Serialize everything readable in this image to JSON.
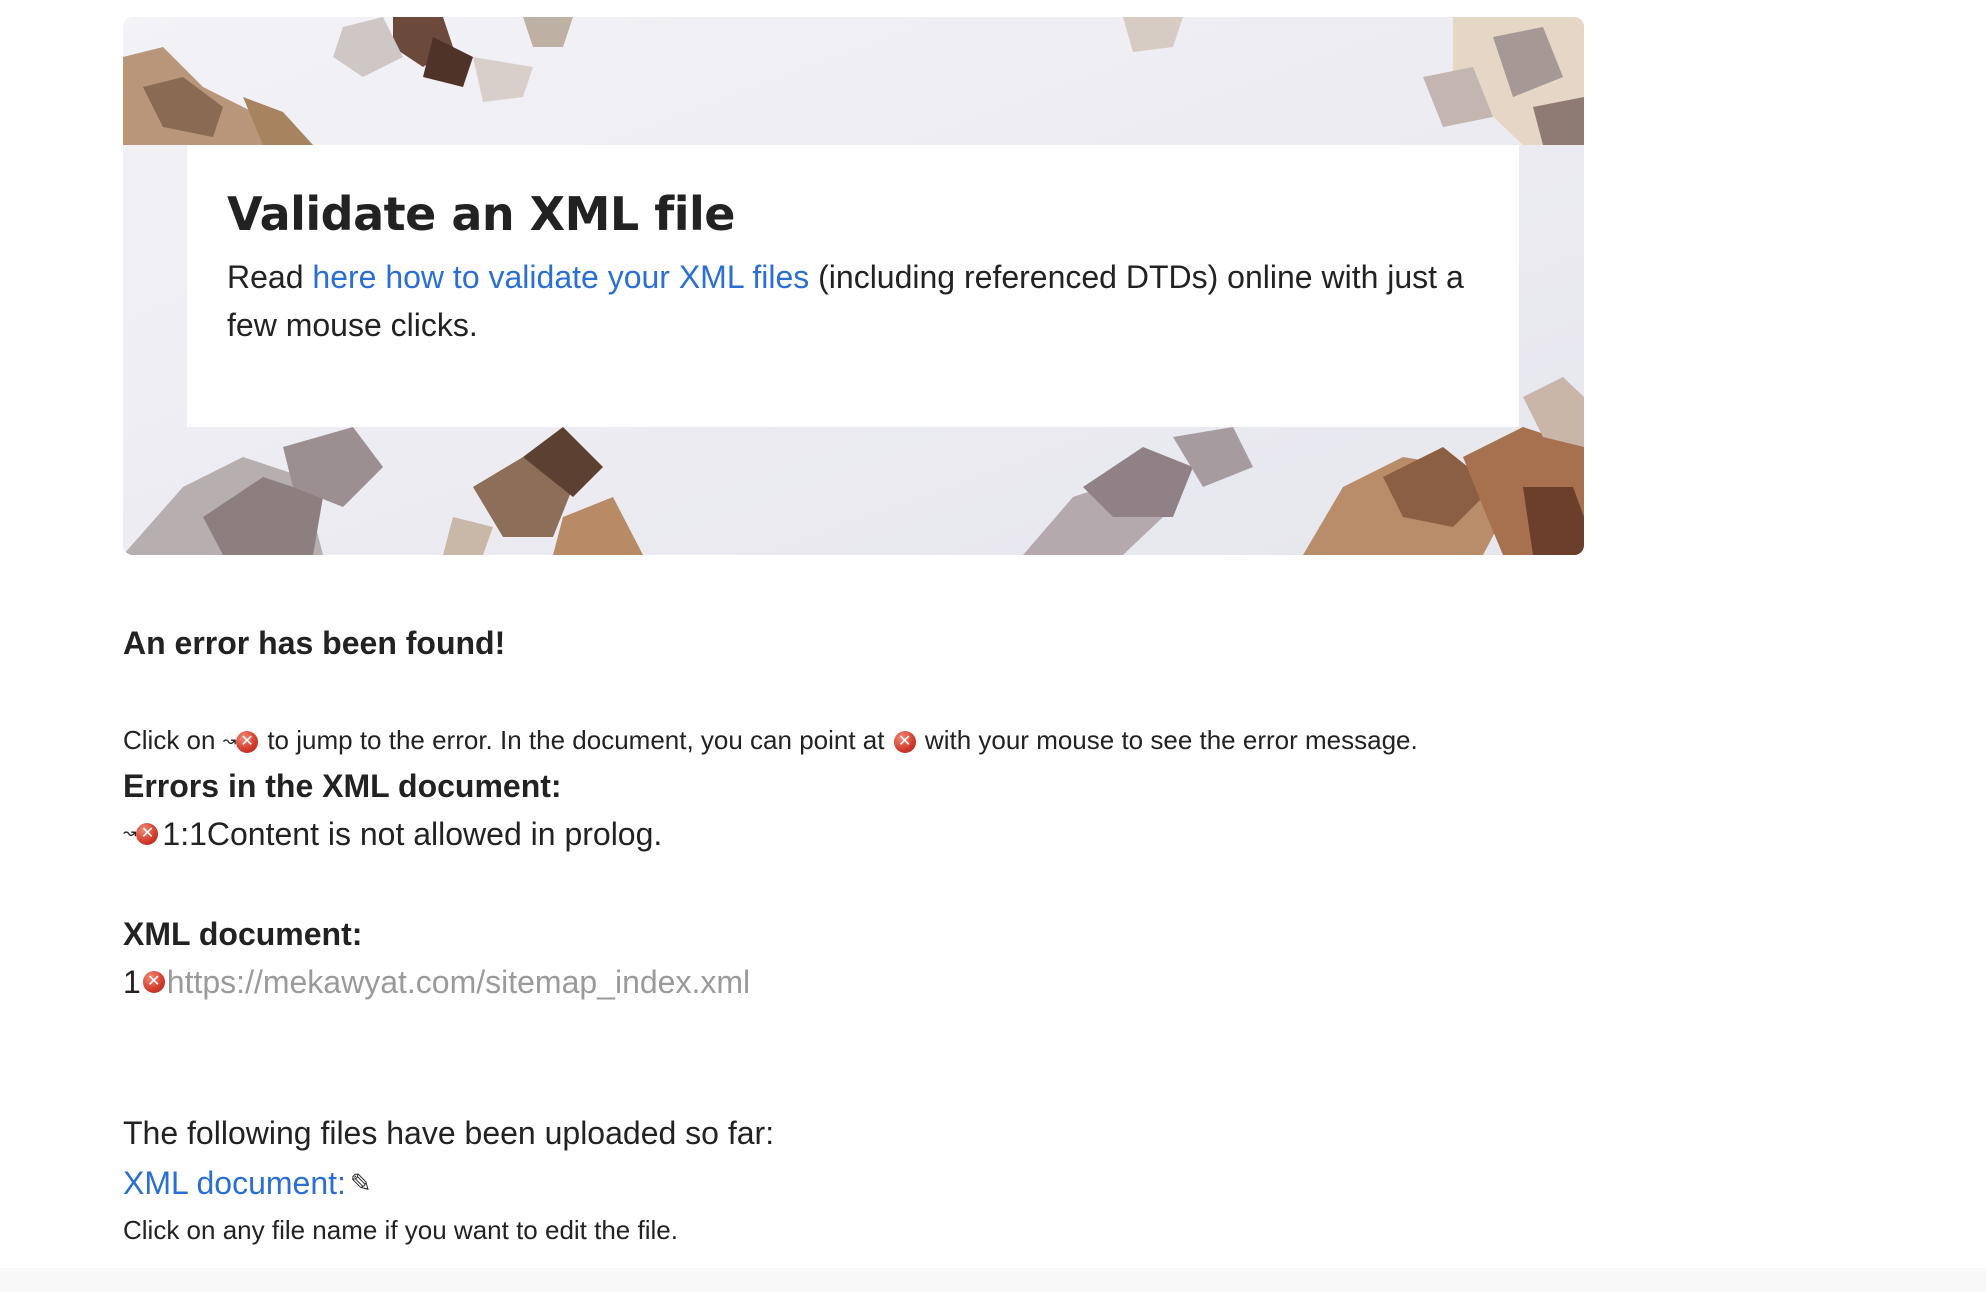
{
  "hero": {
    "title": "Validate an XML file",
    "lead_prefix": "Read ",
    "lead_link": "here how to validate your XML files",
    "lead_suffix": " (including referenced DTDs) online with just a few mouse clicks."
  },
  "result": {
    "heading": "An error has been found!",
    "hint_part1": "Click on ",
    "hint_part2": " to jump to the error. In the document, you can point at ",
    "hint_part3": " with your mouse to see the error message."
  },
  "errors": {
    "heading": "Errors in the XML document:",
    "items": [
      {
        "position": "1:1",
        "message": "Content is not allowed in prolog."
      }
    ]
  },
  "document": {
    "heading": "XML document:",
    "lines": [
      {
        "number": "1",
        "text": "https://mekawyat.com/sitemap_index.xml"
      }
    ]
  },
  "files": {
    "intro": "The following files have been uploaded so far:",
    "link_label": "XML document:",
    "note": "Click on any file name if you want to edit the file."
  },
  "icons": {
    "error": "error-x-icon",
    "jump": "jump-arrow-icon",
    "edit": "pencil-icon"
  },
  "colors": {
    "link": "#2a6fd6",
    "error": "#d23a2a",
    "code_text": "#9a9a9a"
  }
}
